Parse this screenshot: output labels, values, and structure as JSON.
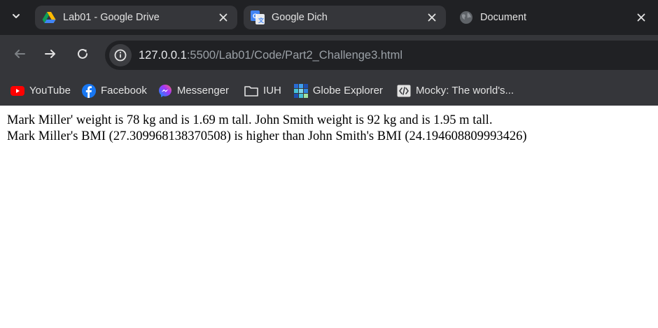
{
  "tabs": [
    {
      "title": "Lab01 - Google Drive",
      "icon": "google-drive-icon",
      "state": "inactive"
    },
    {
      "title": "Google Dich",
      "icon": "google-translate-icon",
      "state": "inactive"
    },
    {
      "title": "Document",
      "icon": "globe-icon",
      "state": "active"
    }
  ],
  "address_bar": {
    "host": "127.0.0.1",
    "path": ":5500/Lab01/Code/Part2_Challenge3.html"
  },
  "bookmarks": [
    {
      "label": "YouTube",
      "icon": "youtube-icon"
    },
    {
      "label": "Facebook",
      "icon": "facebook-icon"
    },
    {
      "label": "Messenger",
      "icon": "messenger-icon"
    },
    {
      "label": "IUH",
      "icon": "folder-icon"
    },
    {
      "label": "Globe Explorer",
      "icon": "globe-explorer-icon"
    },
    {
      "label": "Mocky: The world's...",
      "icon": "code-icon"
    }
  ],
  "page": {
    "line1": "Mark Miller' weight is 78 kg and is 1.69 m tall. John Smith weight is 92 kg and is 1.95 m tall.",
    "line2": "Mark Miller's BMI (27.309968138370508) is higher than John Smith's BMI (24.194608809993426)"
  },
  "colors": {
    "frame": "#202124",
    "toolbar": "#35363a",
    "text_light": "#e3e3e3",
    "url_dim": "#9aa0a6"
  }
}
